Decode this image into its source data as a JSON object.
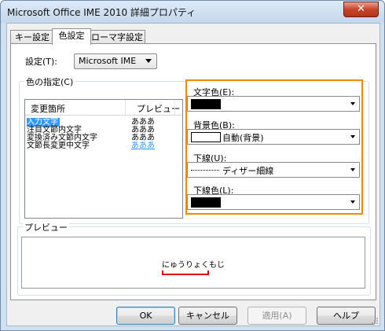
{
  "window": {
    "title": "Microsoft Office IME 2010 詳細プロパティ",
    "close_label": "✕"
  },
  "tabs": [
    "キー設定",
    "色設定",
    "ローマ字設定"
  ],
  "settings": {
    "label": "設定(T):",
    "value": "Microsoft IME"
  },
  "color_group": {
    "title": "色の指定(C)",
    "columns": [
      "変更箇所",
      "プレビュー"
    ],
    "rows": [
      {
        "name": "入力文字",
        "preview": "あああ",
        "selected": true
      },
      {
        "name": "注目文節内文字",
        "preview": "あああ",
        "selected": false
      },
      {
        "name": "変換済み文節内文字",
        "preview": "あああ",
        "selected": false
      },
      {
        "name": "文節長変更中文字",
        "preview": "あああ",
        "selected": false
      }
    ]
  },
  "props": {
    "text_color": {
      "label": "文字色(E):",
      "swatch": "#000000"
    },
    "bg_color": {
      "label": "背景色(B):",
      "value": "自動(背景)",
      "swatch": "#ffffff"
    },
    "underline": {
      "label": "下線(U):",
      "value": "ディザー細線"
    },
    "underline_color": {
      "label": "下線色(L):",
      "swatch": "#000000"
    }
  },
  "preview_group": {
    "title": "プレビュー",
    "sample": "にゅうりょくもじ"
  },
  "buttons": {
    "ok": "OK",
    "cancel": "キャンセル",
    "apply": "適用(A)",
    "help": "ヘルプ"
  },
  "colors": {
    "highlight": "#f08a00",
    "selection": "#3399ff",
    "preview_text_blue": "#3399ff",
    "preview_underline": "#e00000"
  }
}
